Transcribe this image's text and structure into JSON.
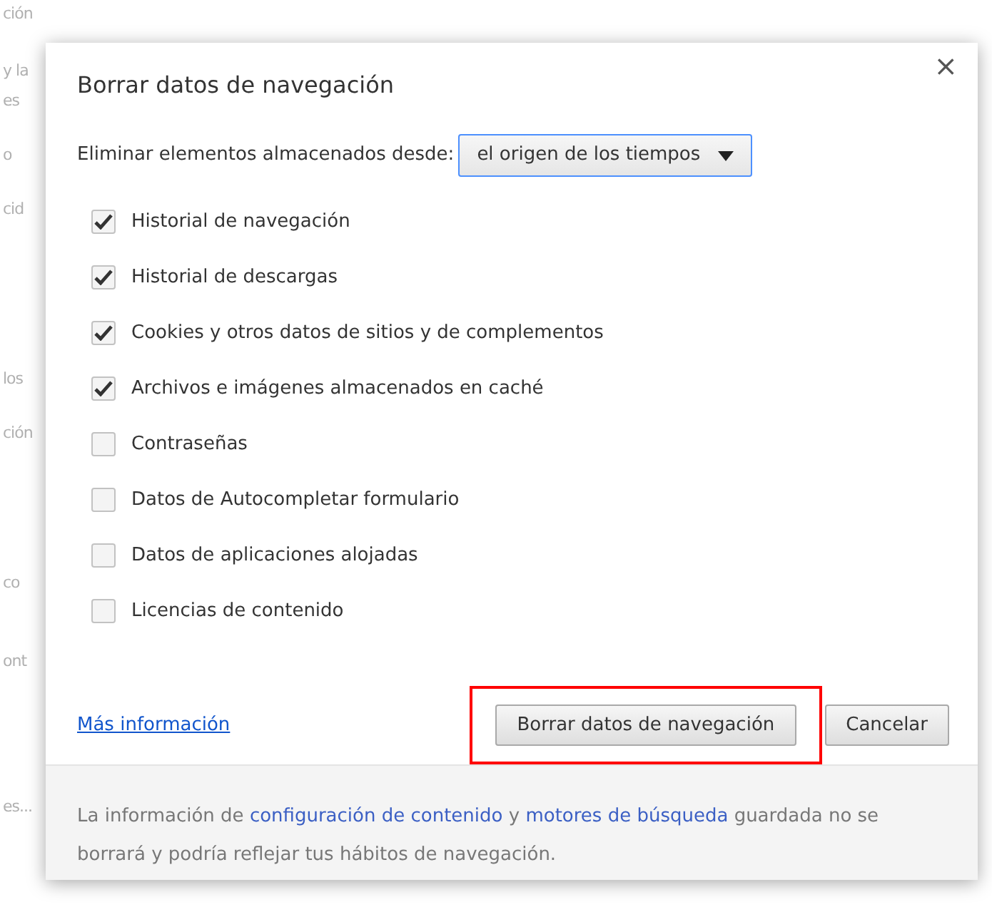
{
  "background_fragments": [
    "ción",
    "y la",
    "es",
    "o",
    "cid",
    "los",
    "ción",
    "co",
    "ont",
    "es..."
  ],
  "dialog": {
    "title": "Borrar datos de navegación",
    "close": "×",
    "range": {
      "label": "Eliminar elementos almacenados desde:",
      "value": "el origen de los tiempos"
    },
    "options": [
      {
        "label": "Historial de navegación",
        "checked": true
      },
      {
        "label": "Historial de descargas",
        "checked": true
      },
      {
        "label": "Cookies y otros datos de sitios y de complementos",
        "checked": true
      },
      {
        "label": "Archivos e imágenes almacenados en caché",
        "checked": true
      },
      {
        "label": "Contraseñas",
        "checked": false
      },
      {
        "label": "Datos de Autocompletar formulario",
        "checked": false
      },
      {
        "label": "Datos de aplicaciones alojadas",
        "checked": false
      },
      {
        "label": "Licencias de contenido",
        "checked": false
      }
    ],
    "more_info_link": "Más información",
    "buttons": [
      {
        "label": "Borrar datos de navegación",
        "highlighted": true
      },
      {
        "label": "Cancelar",
        "highlighted": false
      }
    ],
    "footer": [
      {
        "kind": "text",
        "text": "La información de "
      },
      {
        "kind": "link",
        "text": "configuración de contenido"
      },
      {
        "kind": "text",
        "text": " y "
      },
      {
        "kind": "link",
        "text": "motores de búsqueda"
      },
      {
        "kind": "text",
        "text": " guardada no se borrará y podría reflejar tus hábitos de navegación."
      }
    ]
  }
}
